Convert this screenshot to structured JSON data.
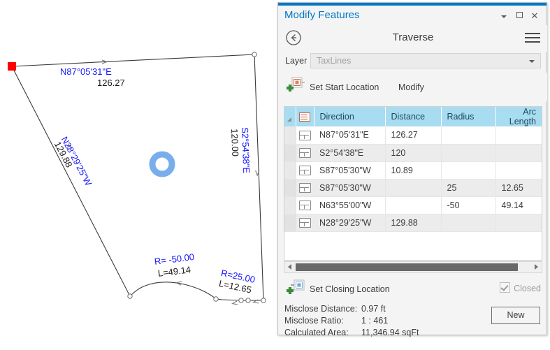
{
  "window": {
    "title": "Modify Features",
    "accent_color": "#0078c8",
    "buttons": {
      "dropdown": "▾",
      "maximize": "□",
      "close": "✕"
    }
  },
  "header": {
    "back_icon": "back-arrow-icon",
    "page_title": "Traverse",
    "menu_icon": "hamburger-menu-icon"
  },
  "layer": {
    "label": "Layer",
    "value": "TaxLines",
    "placeholder": "TaxLines"
  },
  "toolbar": {
    "start_icon": "set-start-location-icon",
    "set_start_label": "Set Start Location",
    "modify_label": "Modify"
  },
  "table": {
    "columns": [
      "Direction",
      "Distance",
      "Radius",
      "Arc Length"
    ],
    "rows": [
      {
        "direction": "N87°05'31\"E",
        "distance": "126.27",
        "radius": "",
        "arc_length": ""
      },
      {
        "direction": "S2°54'38\"E",
        "distance": "120",
        "radius": "",
        "arc_length": ""
      },
      {
        "direction": "S87°05'30\"W",
        "distance": "10.89",
        "radius": "",
        "arc_length": ""
      },
      {
        "direction": "S87°05'30\"W",
        "distance": "",
        "radius": "25",
        "arc_length": "12.65"
      },
      {
        "direction": "N63°55'00\"W",
        "distance": "",
        "radius": "-50",
        "arc_length": "49.14"
      },
      {
        "direction": "N28°29'25\"W",
        "distance": "129.88",
        "radius": "",
        "arc_length": ""
      }
    ]
  },
  "closing": {
    "icon": "set-closing-location-icon",
    "label": "Set Closing Location",
    "closed_label": "Closed",
    "closed_checked": true
  },
  "stats": {
    "misclose_distance_label": "Misclose Distance:",
    "misclose_distance_value": "0.97 ft",
    "misclose_ratio_label": "Misclose Ratio:",
    "misclose_ratio_value": "1 : 461",
    "calculated_area_label": "Calculated Area:",
    "calculated_area_value": "11,346.94 sqFt"
  },
  "actions": {
    "new_label": "New"
  },
  "map": {
    "start_point_color": "#ff0000",
    "label_color": "#1414ff",
    "distance_color": "#1a1a1a",
    "center_marker_color": "#79aeec",
    "labels": [
      {
        "name": "north-course-label",
        "direction": "N87°05'31\"E",
        "distance": "126.27"
      },
      {
        "name": "east-course-label",
        "direction": "S2°54'38\"E",
        "distance": "120.00"
      },
      {
        "name": "west-course-label",
        "direction": "N28°29'25\"W",
        "distance": "129.88"
      },
      {
        "name": "curve-left-label",
        "radius": "R= -50.00",
        "arc": "L=49.14"
      },
      {
        "name": "curve-right-label",
        "radius": "R=25.00",
        "arc": "L=12.65"
      }
    ]
  }
}
